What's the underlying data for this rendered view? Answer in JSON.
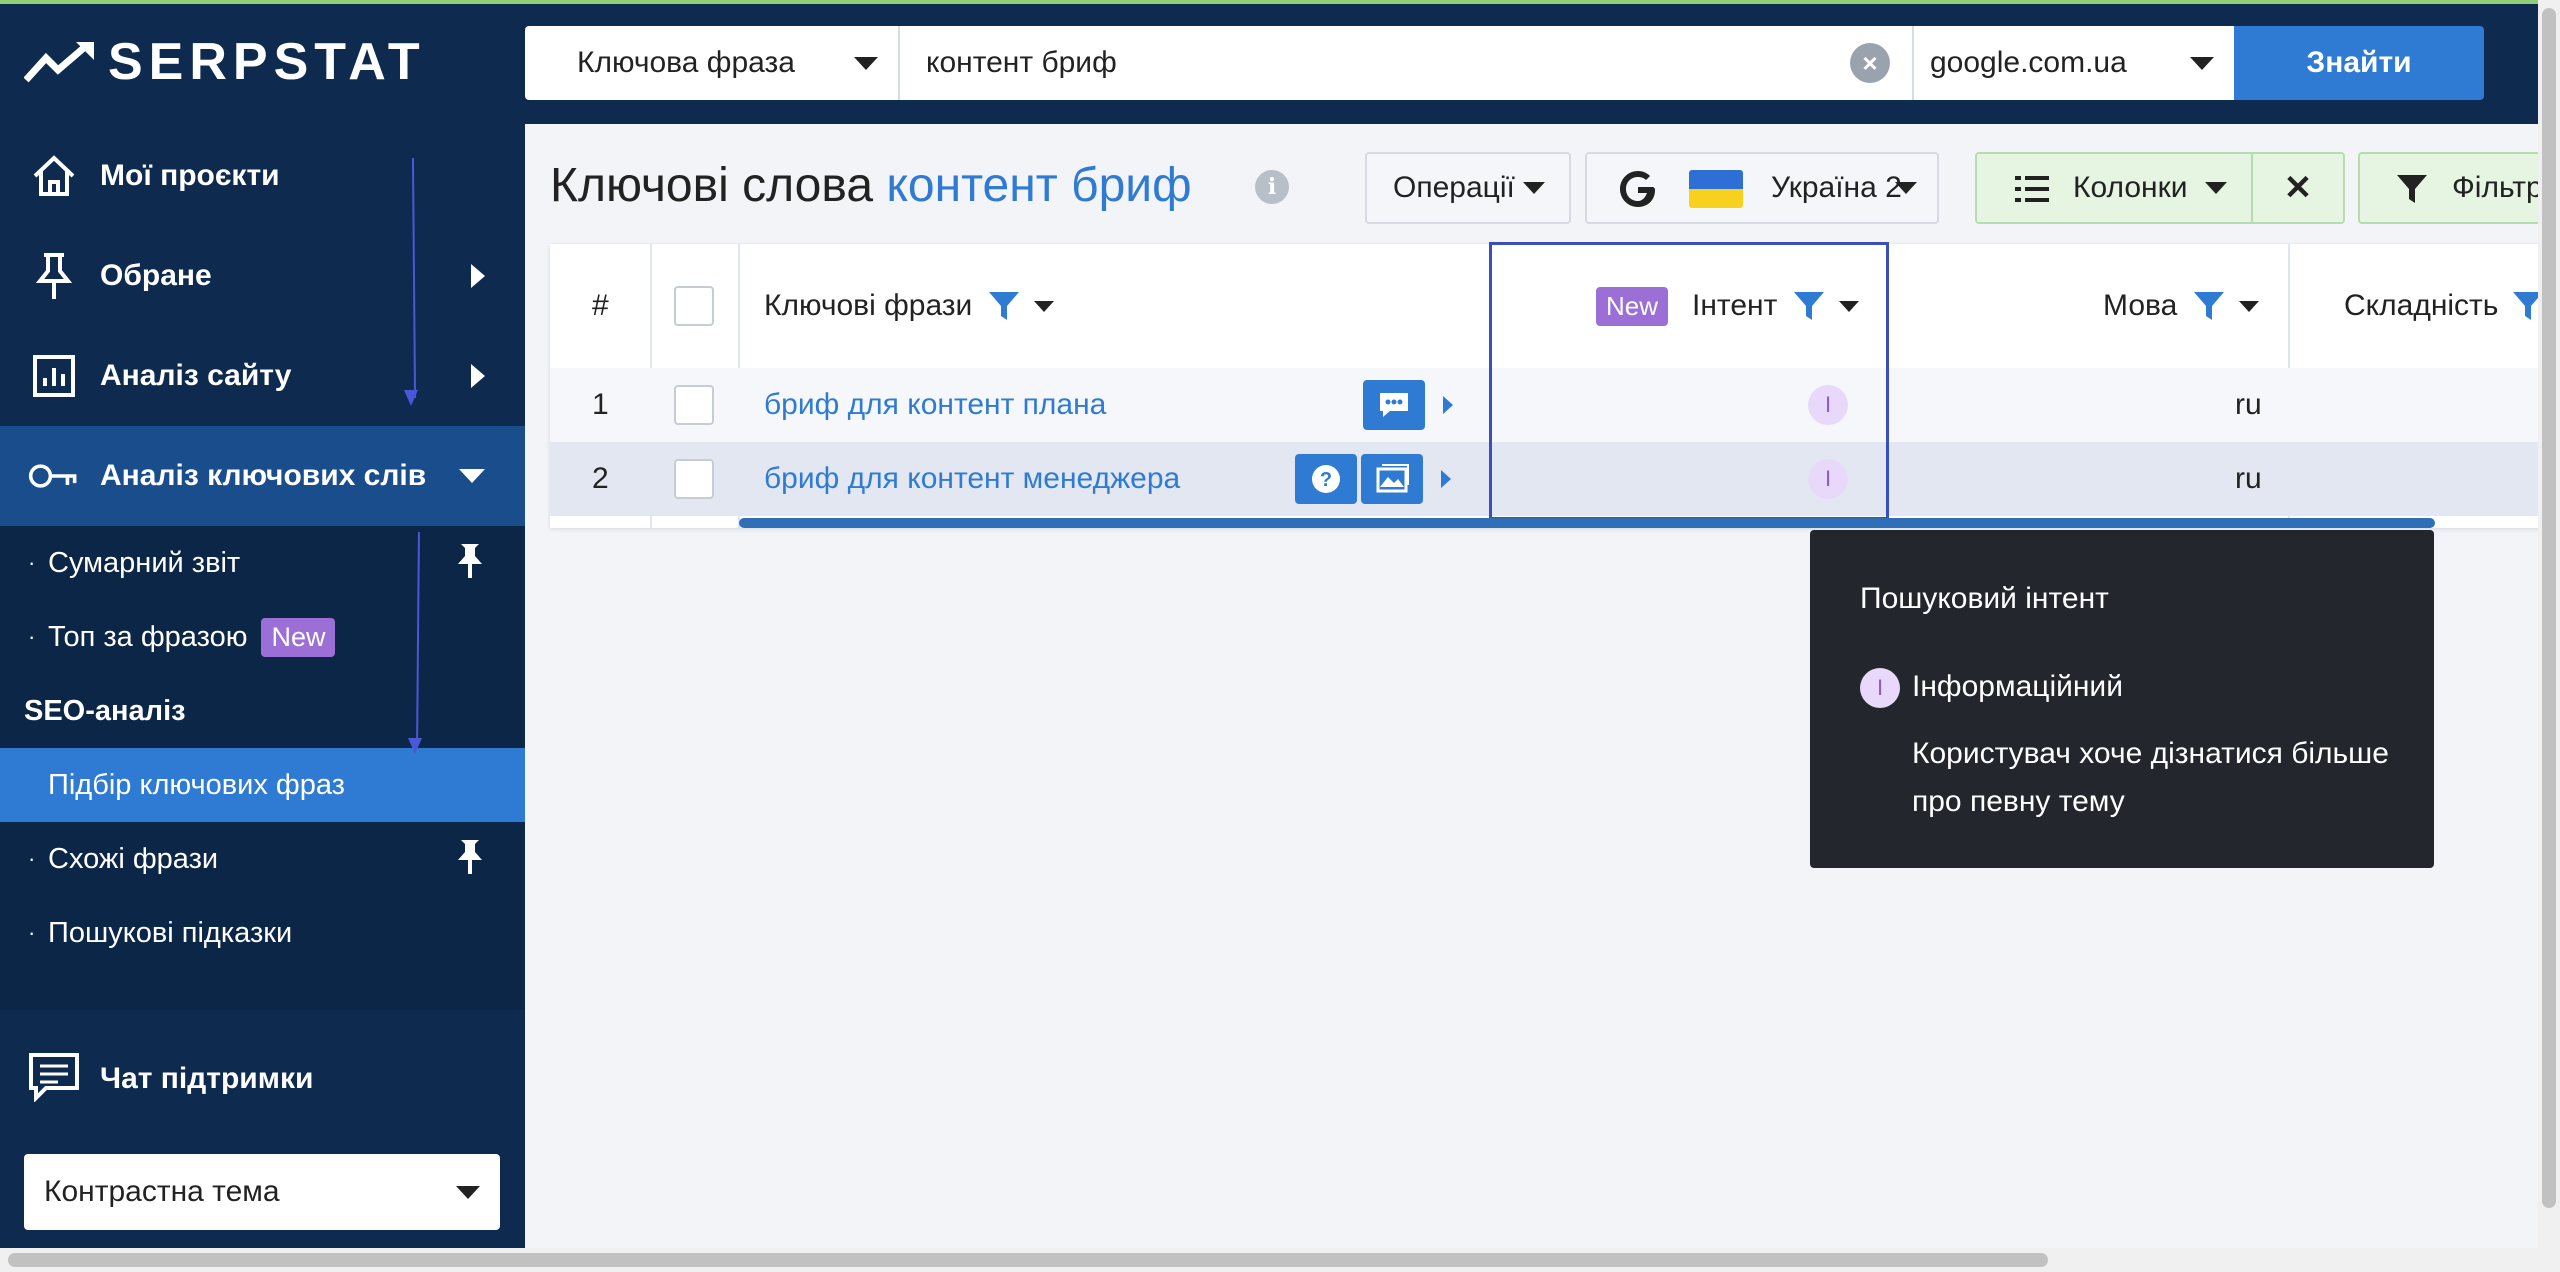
{
  "brand": {
    "logo_text": "SERPSTAT"
  },
  "sidebar": {
    "items": [
      {
        "label": "Мої проєкти"
      },
      {
        "label": "Обране"
      },
      {
        "label": "Аналіз сайту"
      },
      {
        "label": "Аналіз ключових слів"
      }
    ],
    "sub_items": [
      {
        "label": "Сумарний звіт"
      },
      {
        "label": "Топ за фразою",
        "badge": "New"
      },
      {
        "label": "SEO-аналіз"
      },
      {
        "label": "Підбір ключових фраз"
      },
      {
        "label": "Схожі фрази"
      },
      {
        "label": "Пошукові підказки"
      }
    ],
    "chat_label": "Чат підтримки",
    "theme_label": "Контрастна тема"
  },
  "search": {
    "type_label": "Ключова фраза",
    "query": "контент бриф",
    "database": "google.com.ua",
    "find_label": "Знайти"
  },
  "page": {
    "title_prefix": "Ключові слова",
    "title_keyword": "контент бриф"
  },
  "toolbar": {
    "operations_label": "Операції",
    "region_label": "Україна 2",
    "columns_label": "Колонки",
    "close_label": "✕",
    "filter_label": "Фільтр"
  },
  "table": {
    "headers": {
      "num": "#",
      "keywords": "Ключові фрази",
      "intent_badge": "New",
      "intent": "Інтент",
      "language": "Мова",
      "difficulty": "Складність"
    },
    "rows": [
      {
        "num": "1",
        "keyword": "бриф для контент плана",
        "intent": "I",
        "language": "ru"
      },
      {
        "num": "2",
        "keyword": "бриф для контент менеджера",
        "intent": "I",
        "language": "ru"
      }
    ]
  },
  "tooltip": {
    "title": "Пошуковий інтент",
    "intent_code": "I",
    "intent_name": "Інформаційний",
    "description": "Користувач хоче дізнатися більше про певну тему"
  },
  "colors": {
    "sidebar_bg": "#0e2a4f",
    "accent": "#2f7bd3",
    "new_badge": "#9b6fd6",
    "tooltip_bg": "#23262d"
  }
}
